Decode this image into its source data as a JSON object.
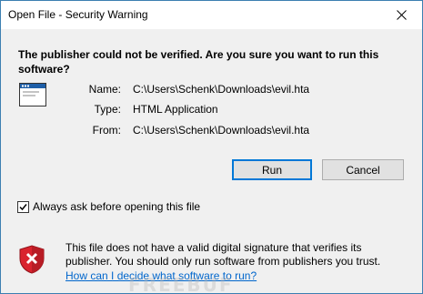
{
  "window": {
    "title": "Open File - Security Warning"
  },
  "heading": {
    "line1": "The publisher could not be verified.  Are you sure you want to run this",
    "line2": "software?"
  },
  "fields": {
    "name_label": "Name:",
    "name_value": "C:\\Users\\Schenk\\Downloads\\evil.hta",
    "type_label": "Type:",
    "type_value": "HTML Application",
    "from_label": "From:",
    "from_value": "C:\\Users\\Schenk\\Downloads\\evil.hta"
  },
  "buttons": {
    "run": "Run",
    "cancel": "Cancel"
  },
  "checkbox": {
    "label": "Always ask before opening this file",
    "checked": true
  },
  "warning": {
    "line1": "This file does not have a valid digital signature that verifies its",
    "line2": "publisher.  You should only run software from publishers you trust.",
    "link": "How can I decide what software to run?"
  },
  "watermark": "FREEBUF",
  "colors": {
    "accent": "#0078d7",
    "link": "#0066cc",
    "shield_red": "#d9232e"
  },
  "icons": {
    "close": "close-icon",
    "file": "application-window-icon",
    "shield": "security-warning-shield-icon",
    "check": "checkmark-icon"
  }
}
